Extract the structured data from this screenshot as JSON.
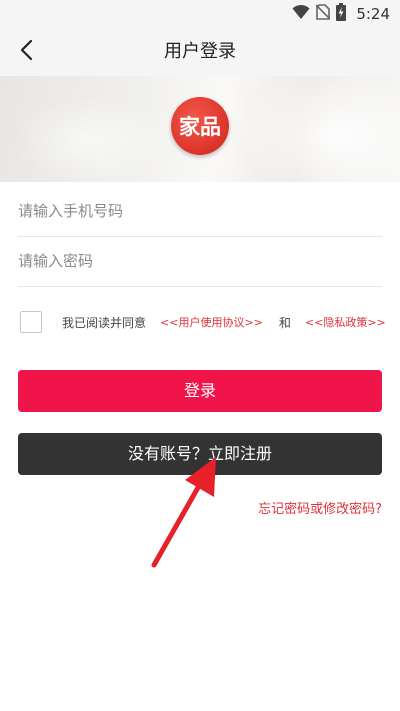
{
  "status_bar": {
    "time": "5:24",
    "icons": [
      "wifi-icon",
      "no-sim-icon",
      "battery-charging-icon"
    ]
  },
  "header": {
    "title": "用户登录",
    "back_icon": "chevron-left-icon"
  },
  "logo": {
    "text": "家品",
    "color": "#e23a30"
  },
  "form": {
    "phone_placeholder": "请输入手机号码",
    "phone_value": "",
    "password_placeholder": "请输入密码",
    "password_value": ""
  },
  "agreement": {
    "checked": false,
    "prefix": "我已阅读并同意",
    "user_agreement": "<<用户使用协议>>",
    "and": "和",
    "privacy_policy": "<<隐私政策>>"
  },
  "buttons": {
    "login_label": "登录",
    "register_label": "没有账号？立即注册",
    "forgot_label": "忘记密码或修改密码?"
  },
  "colors": {
    "login_button": "#f0144b",
    "register_button": "#333333",
    "link": "#e0303c",
    "annotation_arrow": "#e8202a"
  }
}
